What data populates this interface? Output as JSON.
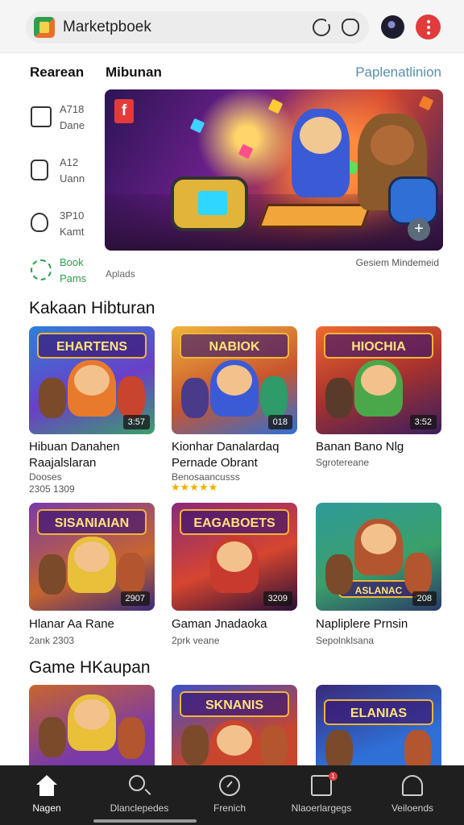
{
  "app": {
    "title": "Marketpboek",
    "accent": "#2e9e4f",
    "menu_color": "#e13b3b"
  },
  "sections": {
    "left_header": "Rearean",
    "main_header": "Mibunan",
    "link": "Paplenatlinion"
  },
  "categories": [
    {
      "line1": "A718",
      "line2": "Dane",
      "icon": "briefcase-icon"
    },
    {
      "line1": "A12",
      "line2": "Uann",
      "icon": "document-icon"
    },
    {
      "line1": "3P10",
      "line2": "Kamt",
      "icon": "shield-icon"
    },
    {
      "line1": "Book",
      "line2": "Pams",
      "icon": "gear-icon",
      "active": true
    }
  ],
  "hero": {
    "badge": "f",
    "caption_left": "Aplads",
    "caption_right": "Gesiem Mindemeid"
  },
  "popular": {
    "title": "Kakaan Hibturan",
    "items": [
      {
        "banner": "EHARTENS",
        "badge": "3:57",
        "title_line1": "Hibuan Danahen",
        "title_line2": "Raajalslaran",
        "sub1": "Dooses",
        "sub2": "2305 1309",
        "bg": "#3a8bd6"
      },
      {
        "banner": "NABIOK",
        "badge": "018",
        "title_line1": "Kionhar Danalardaq",
        "title_line2": "Pernade Obrant",
        "sub1": "Benosaancusss",
        "rating": 5,
        "bg": "#e0a23a"
      },
      {
        "banner": "HIOCHIA",
        "badge": "3:52",
        "title_line1": "Banan Bano Nlg",
        "sub1": "Sgrotereane",
        "bg": "#d8572e"
      },
      {
        "banner": "SISANIAIAN",
        "badge": "2907",
        "title_line1": "Hlanar Aa Rane",
        "sub1": "2ank 2303",
        "bg": "#7a3aa8"
      },
      {
        "banner": "EAGABOETS",
        "badge": "3209",
        "title_line1": "Gaman Jnadaoka",
        "sub1": "2prk veane",
        "bg": "#8a2a7a"
      },
      {
        "banner": "ASLANAC",
        "badge": "208",
        "title_line1": "Napliplere Prnsin",
        "sub1": "Sepolnklsana",
        "bg": "#2f9a9a"
      }
    ]
  },
  "recommended": {
    "title": "Game HKaupan",
    "items": [
      {
        "banner": "",
        "bg": "#c8652e"
      },
      {
        "banner": "SKNANIS",
        "bg": "#3d4fc8"
      },
      {
        "banner": "ELANIAS",
        "bg": "#3a2a7a"
      }
    ]
  },
  "nav": [
    {
      "label": "Nagen",
      "icon": "home-icon",
      "active": true
    },
    {
      "label": "Dlanclepedes",
      "icon": "search-icon"
    },
    {
      "label": "Frenich",
      "icon": "compass-icon"
    },
    {
      "label": "Nlaoerlargegs",
      "icon": "inbox-icon",
      "notification": "1"
    },
    {
      "label": "Veiloends",
      "icon": "user-icon"
    }
  ]
}
